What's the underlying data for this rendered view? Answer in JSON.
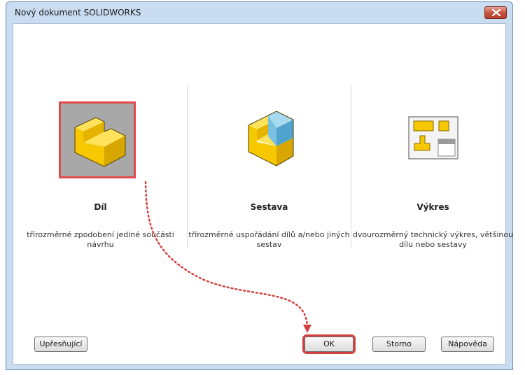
{
  "window": {
    "title": "Nový dokument SOLIDWORKS"
  },
  "templates": [
    {
      "name": "Díl",
      "description": "třírozměrné zpodobení jediné součásti návrhu"
    },
    {
      "name": "Sestava",
      "description": "třírozměrné uspořádání dílů a/nebo jiných sestav"
    },
    {
      "name": "Výkres",
      "description": "dvourozměrný technický výkres, většinou dílu nebo sestavy"
    }
  ],
  "buttons": {
    "advanced": "Upřesňující",
    "ok": "OK",
    "cancel": "Storno",
    "help": "Nápověda"
  },
  "icons": {
    "close": "close-icon",
    "part": "part-icon",
    "assembly": "assembly-icon",
    "drawing": "drawing-icon"
  },
  "colors": {
    "selection_highlight": "#e04a4a",
    "part_yellow": "#f5c400",
    "assembly_blue": "#6cb8dc"
  }
}
